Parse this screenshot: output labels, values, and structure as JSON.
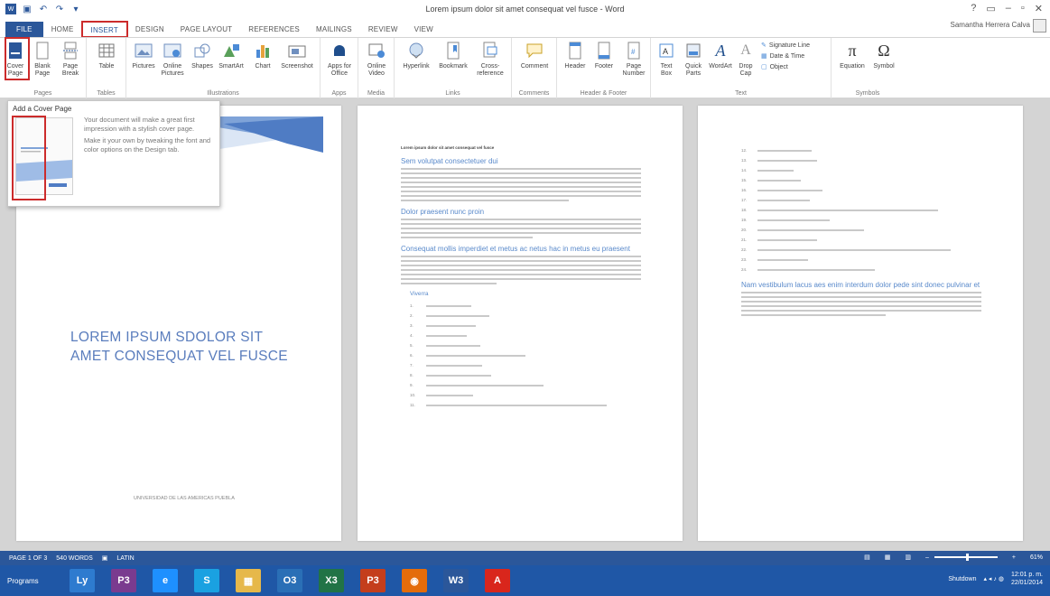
{
  "window": {
    "title": "Lorem ipsum dolor sit amet consequat vel fusce - Word",
    "user": "Samantha Herrera Calva",
    "controls": [
      "?",
      "▭",
      "–",
      "▫",
      "✕"
    ]
  },
  "tabs": [
    "FILE",
    "HOME",
    "INSERT",
    "DESIGN",
    "PAGE LAYOUT",
    "REFERENCES",
    "MAILINGS",
    "REVIEW",
    "VIEW"
  ],
  "ribbon": {
    "pages": {
      "label": "Pages",
      "items": [
        "Cover Page",
        "Blank Page",
        "Page Break"
      ]
    },
    "tables": {
      "label": "Tables",
      "items": [
        "Table"
      ]
    },
    "illustrations": {
      "label": "Illustrations",
      "items": [
        "Pictures",
        "Online Pictures",
        "Shapes",
        "SmartArt",
        "Chart",
        "Screenshot"
      ]
    },
    "apps": {
      "label": "Apps",
      "items": [
        "Apps for Office"
      ]
    },
    "media": {
      "label": "Media",
      "items": [
        "Online Video"
      ]
    },
    "links": {
      "label": "Links",
      "items": [
        "Hyperlink",
        "Bookmark",
        "Cross-reference"
      ]
    },
    "comments": {
      "label": "Comments",
      "items": [
        "Comment"
      ]
    },
    "header_footer": {
      "label": "Header & Footer",
      "items": [
        "Header",
        "Footer",
        "Page Number"
      ]
    },
    "text": {
      "label": "Text",
      "items": [
        "Text Box",
        "Quick Parts",
        "WordArt",
        "Drop Cap"
      ],
      "small": [
        "Signature Line",
        "Date & Time",
        "Object"
      ]
    },
    "symbols": {
      "label": "Symbols",
      "items": [
        "Equation",
        "Symbol"
      ]
    }
  },
  "flyout": {
    "title": "Add a Cover Page",
    "desc1": "Your document will make a great first impression with a stylish cover page.",
    "desc2": "Make it your own by tweaking the font and color options on the Design tab."
  },
  "cover": {
    "title_line1": "LOREM IPSUM SDOLOR SIT",
    "title_line2": "AMET CONSEQUAT VEL FUSCE",
    "footer": "UNIVERSIDAD DE LAS AMERICAS PUEBLA"
  },
  "page2": {
    "heading_small": "Lorem ipsum dolor sit amet consequat vel fusce",
    "h1": "Sem volutpat consectetuer dui",
    "h2": "Dolor praesent nunc proin",
    "h3": "Consequat mollis imperdiet et metus ac netus hac in metus eu praesent",
    "h4": "Viverra",
    "numbers": [
      "1.",
      "2.",
      "3.",
      "4.",
      "5.",
      "6.",
      "7.",
      "8.",
      "9.",
      "10.",
      "11."
    ]
  },
  "page3": {
    "numbers": [
      "12.",
      "13.",
      "14.",
      "15.",
      "16.",
      "17.",
      "18.",
      "19.",
      "20.",
      "21.",
      "22.",
      "23.",
      "24."
    ],
    "h1": "Nam vestibulum lacus aes enim interdum dolor pede sint donec pulvinar et"
  },
  "status": {
    "page": "PAGE 1 OF 3",
    "words": "540 WORDS",
    "lang": "LATIN",
    "zoom": "61%",
    "zoom_fraction": 0.61
  },
  "taskbar": {
    "start": "Programs",
    "apps": [
      "Ly",
      "P3",
      "e",
      "S",
      "▦",
      "O3",
      "X3",
      "P3",
      "◉",
      "W3",
      "A"
    ],
    "app_colors": [
      "#2e7bcf",
      "#7a3b8f",
      "#1e90ff",
      "#1aa1e1",
      "#e6b84a",
      "#2a6fb6",
      "#217346",
      "#c43e1c",
      "#e46c0a",
      "#2b579a",
      "#d9261c"
    ],
    "tray_label": "Shutdown",
    "time": "12:01 p. m.",
    "date": "22/01/2014"
  }
}
